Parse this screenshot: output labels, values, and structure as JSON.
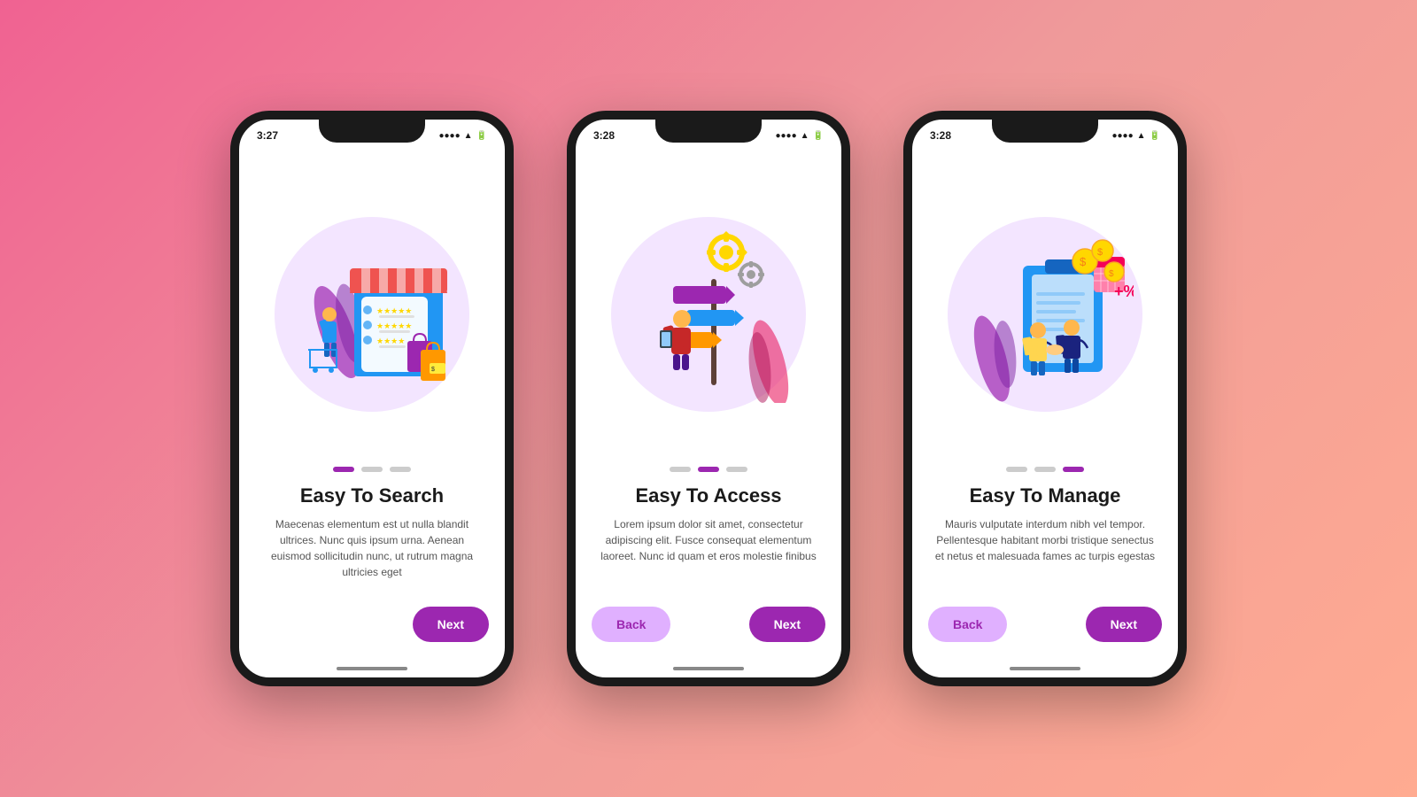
{
  "background": {
    "gradient": "135deg, #f06292 0%, #ef9a9a 50%, #ffab91 100%"
  },
  "phones": [
    {
      "id": "phone-1",
      "status_time": "3:27",
      "illustration": "shopping",
      "dots": [
        "active",
        "inactive",
        "inactive"
      ],
      "title": "Easy To Search",
      "body": "Maecenas elementum est ut nulla blandit ultrices. Nunc quis ipsum urna. Aenean euismod sollicitudin nunc, ut rutrum magna ultricies eget",
      "buttons": {
        "next_label": "Next",
        "show_back": false
      }
    },
    {
      "id": "phone-2",
      "status_time": "3:28",
      "illustration": "access",
      "dots": [
        "inactive",
        "active",
        "inactive"
      ],
      "title": "Easy To Access",
      "body": "Lorem ipsum dolor sit amet, consectetur adipiscing elit. Fusce consequat elementum laoreet. Nunc id quam et eros molestie finibus",
      "buttons": {
        "next_label": "Next",
        "back_label": "Back",
        "show_back": true
      }
    },
    {
      "id": "phone-3",
      "status_time": "3:28",
      "illustration": "manage",
      "dots": [
        "inactive",
        "inactive",
        "active"
      ],
      "title": "Easy To Manage",
      "body": "Mauris vulputate interdum nibh vel tempor. Pellentesque habitant morbi tristique senectus et netus et malesuada fames ac turpis egestas",
      "buttons": {
        "next_label": "Next",
        "back_label": "Back",
        "show_back": true
      }
    }
  ]
}
